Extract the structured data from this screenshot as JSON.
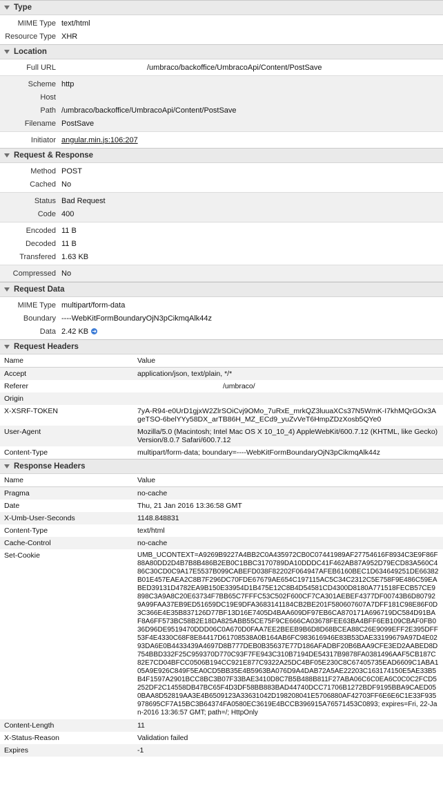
{
  "type": {
    "title": "Type",
    "rows": [
      {
        "k": "MIME Type",
        "v": "text/html"
      },
      {
        "k": "Resource Type",
        "v": "XHR"
      }
    ]
  },
  "location": {
    "title": "Location",
    "full_url_label": "Full URL",
    "full_url": "/umbraco/backoffice/UmbracoApi/Content/PostSave",
    "scheme_label": "Scheme",
    "scheme": "http",
    "host_label": "Host",
    "host": "",
    "path_label": "Path",
    "path": "/umbraco/backoffice/UmbracoApi/Content/PostSave",
    "filename_label": "Filename",
    "filename": "PostSave",
    "initiator_label": "Initiator",
    "initiator": "angular.min.js:106:207"
  },
  "reqres": {
    "title": "Request & Response",
    "method_label": "Method",
    "method": "POST",
    "cached_label": "Cached",
    "cached": "No",
    "status_label": "Status",
    "status": "Bad Request",
    "code_label": "Code",
    "code": "400",
    "encoded_label": "Encoded",
    "encoded": "11 B",
    "decoded_label": "Decoded",
    "decoded": "11 B",
    "transfered_label": "Transfered",
    "transfered": "1.63 KB",
    "compressed_label": "Compressed",
    "compressed": "No"
  },
  "reqdata": {
    "title": "Request Data",
    "mime_label": "MIME Type",
    "mime": "multipart/form-data",
    "boundary_label": "Boundary",
    "boundary": "----WebKitFormBoundaryOjN3pCikmqAlk44z",
    "data_label": "Data",
    "data": "2.42 KB"
  },
  "reqheaders": {
    "title": "Request Headers",
    "col_name": "Name",
    "col_value": "Value",
    "rows": [
      {
        "name": "Accept",
        "value": "application/json, text/plain, */*"
      },
      {
        "name": "Referer",
        "value": "/umbraco/"
      },
      {
        "name": "Origin",
        "value": ""
      },
      {
        "name": "X-XSRF-TOKEN",
        "value": "7yA-R94-e0UrD1gjxW2ZlrSOiCvj9OMo_7uRxE_mrkQZ3luuaXCs37N5WmK-I7khMQrGOx3AgeTSO-6belYYy58DX_arTB86H_MZ_ECd9_yuZvVeT6HmpZDzXosb5QYe0"
      },
      {
        "name": "User-Agent",
        "value": "Mozilla/5.0 (Macintosh; Intel Mac OS X 10_10_4) AppleWebKit/600.7.12 (KHTML, like Gecko) Version/8.0.7 Safari/600.7.12"
      },
      {
        "name": "Content-Type",
        "value": "multipart/form-data; boundary=----WebKitFormBoundaryOjN3pCikmqAlk44z"
      }
    ]
  },
  "resheaders": {
    "title": "Response Headers",
    "col_name": "Name",
    "col_value": "Value",
    "rows": [
      {
        "name": "Pragma",
        "value": "no-cache"
      },
      {
        "name": "Date",
        "value": "Thu, 21 Jan 2016 13:36:58 GMT"
      },
      {
        "name": "X-Umb-User-Seconds",
        "value": "1148.848831"
      },
      {
        "name": "Content-Type",
        "value": "text/html"
      },
      {
        "name": "Cache-Control",
        "value": "no-cache"
      },
      {
        "name": "Set-Cookie",
        "value": "UMB_UCONTEXT=A9269B9227A4BB2C0A435972CB0C07441989AF27754616F8934C3E9F86F88A80DD2D4B7B8B486B2EB0C1BBC3170789DA10DDDC41F462AB87A952D79ECD83A560C486C30CD0C9A17E5537B099CABEFD038F82202F064947AFEB6160BEC1D634649251DE66382B01E457EAEA2C8B7F296DC70FDE67679AE654C197115AC5C34C2312C5E758F9E486C59EABED39131D4782EA9B150E33954D1B475E12C8B4D54581CD4300D8180A771518FECB57CE9898C3A9A8C20E63734F7BB65C7FFFC53C502F600CF7CA301AEBEF4377DF00743B6D807929A99FAA37EB9ED51659DC19E9DFA3683141184CB2BE201F580607607A7DFF181C98E86F0D3C366E4E35B837126D77BF13D16E7405D4BAA609DF97EB6CA870171A696719DC584D91BAF8A6FF573BC58B2E18DA825ABB55CE75F9CE666CA03678FEE63BA4BFF6EB109CBAF0FB036D96DE9519470DDD06C0A670D0FAA7EE2BEEB9B6D8D68BCEA88C26E9099EFF2E395DFF53F4E4330C68F8E84417D61708538A0B164AB6FC983616946E83B53DAE33199679A97D4E0293DA6E0B4433439A4697D8B777DEB0B35637E77D186AFADBF20B6BAA9CFE3ED2AABED8D754BBD332F25C959370D770C93F7FE943C310B7194DE54317B9878FA0381496AAF5CB187C82E7CD04BFCC0506B194CC921E877C9322A25DC4BF05E230C8C67405735EAD6609C1ABA105A9E926C849F5EA0CD5BB35E4B5963BA076D9A4DAB72A5AE22203C163174150E5AE33B5B4F1597A2901BCC8BC3B07F33BAE3410D8C7B5B488B811F27ABA06C6C0EA6C0C0C2FCD5252DF2C14558DB47BC65F4D3DF58BB883BAD44740DCC71706B1272BDF9195BBA9CAED050BAA8D52819AA3E4B6509123A33631042D198208041E5706880AF42703FF6E6E6C1E33F935978695CF7A15BC3B64374FA0580EC3619E4BCCB396915A76571453C0893; expires=Fri, 22-Jan-2016 13:36:57 GMT; path=/; HttpOnly"
      },
      {
        "name": "Content-Length",
        "value": "11"
      },
      {
        "name": "X-Status-Reason",
        "value": "Validation failed"
      },
      {
        "name": "Expires",
        "value": "-1"
      }
    ]
  }
}
